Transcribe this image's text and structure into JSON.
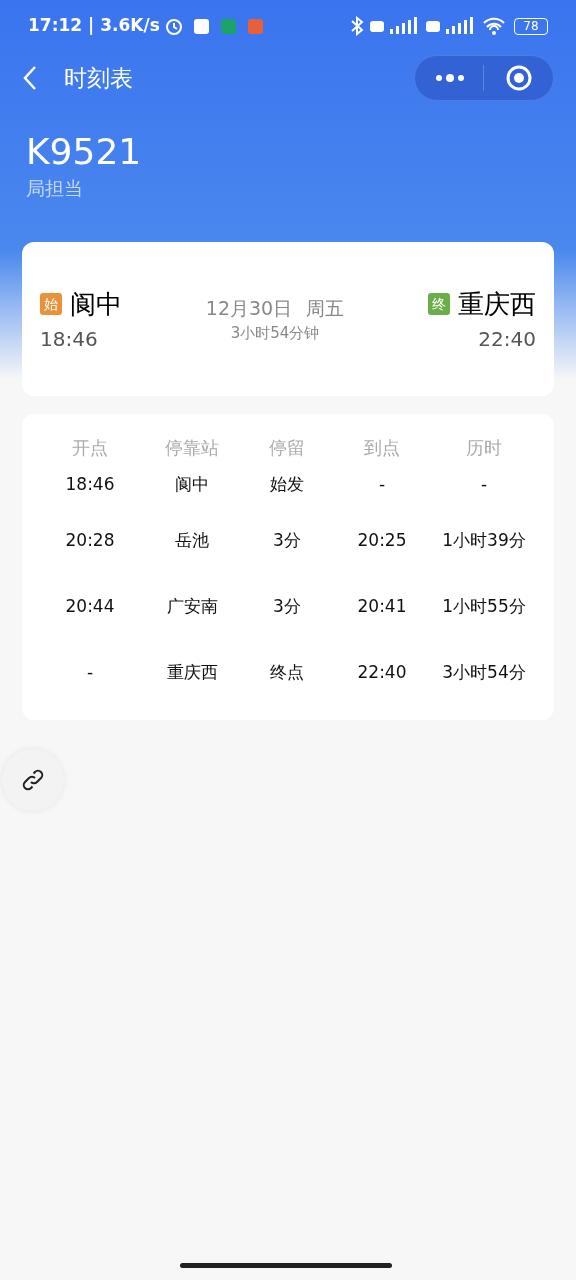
{
  "status_bar": {
    "time": "17:12 | 3.6K/s",
    "battery": "78"
  },
  "nav": {
    "title": "时刻表"
  },
  "train": {
    "number": "K9521",
    "subtitle": "局担当"
  },
  "journey": {
    "from": {
      "badge": "始",
      "color": "#e8923a",
      "station": "阆中",
      "time": "18:46"
    },
    "date": "12月30日",
    "weekday": "周五",
    "duration": "3小时54分钟",
    "to": {
      "badge": "终",
      "color": "#6aae4a",
      "station": "重庆西",
      "time": "22:40"
    }
  },
  "table": {
    "columns": [
      "开点",
      "停靠站",
      "停留",
      "到点",
      "历时"
    ],
    "rows": [
      [
        "18:46",
        "阆中",
        "始发",
        "-",
        "-"
      ],
      [
        "20:28",
        "岳池",
        "3分",
        "20:25",
        "1小时39分"
      ],
      [
        "20:44",
        "广安南",
        "3分",
        "20:41",
        "1小时55分"
      ],
      [
        "-",
        "重庆西",
        "终点",
        "22:40",
        "3小时54分"
      ]
    ]
  }
}
